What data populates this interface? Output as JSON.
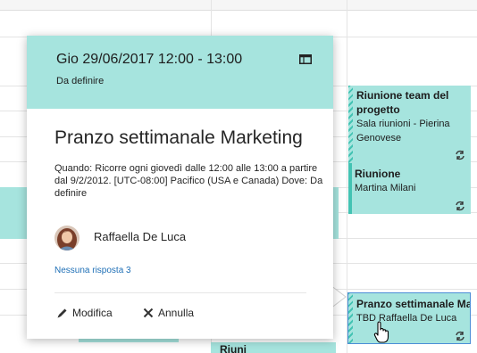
{
  "calendar": {
    "events": [
      {
        "title": "Riunione team del progetto",
        "location": "Sala riunioni - Pierina Genovese",
        "recurring": true
      },
      {
        "title": "Riunione",
        "location": "Martina Milani",
        "recurring": true
      },
      {
        "title": "Pranzo settimanale Mark",
        "location": "TBD Raffaella De Luca",
        "recurring": true
      },
      {
        "title": "Riuni"
      }
    ]
  },
  "popup": {
    "datetime": "Gio 29/06/2017 12:00 - 13:00",
    "location_header": "Da definire",
    "title": "Pranzo settimanale Marketing",
    "description": "Quando: Ricorre ogni giovedì dalle 12:00 alle 13:00 a partire dal 9/2/2012. [UTC-08:00] Pacifico (USA e Canada) Dove: Da definire",
    "organizer": "Raffaella De Luca",
    "responses_link": "Nessuna risposta 3",
    "edit_label": "Modifica",
    "cancel_label": "Annulla"
  },
  "colors": {
    "event_fill": "#a6e4de",
    "event_accent": "#43c3b3",
    "link": "#1e6fb6"
  },
  "icons": [
    "calendar-view-icon",
    "pencil-icon",
    "x-icon",
    "recurrence-icon",
    "hand-cursor-icon"
  ]
}
